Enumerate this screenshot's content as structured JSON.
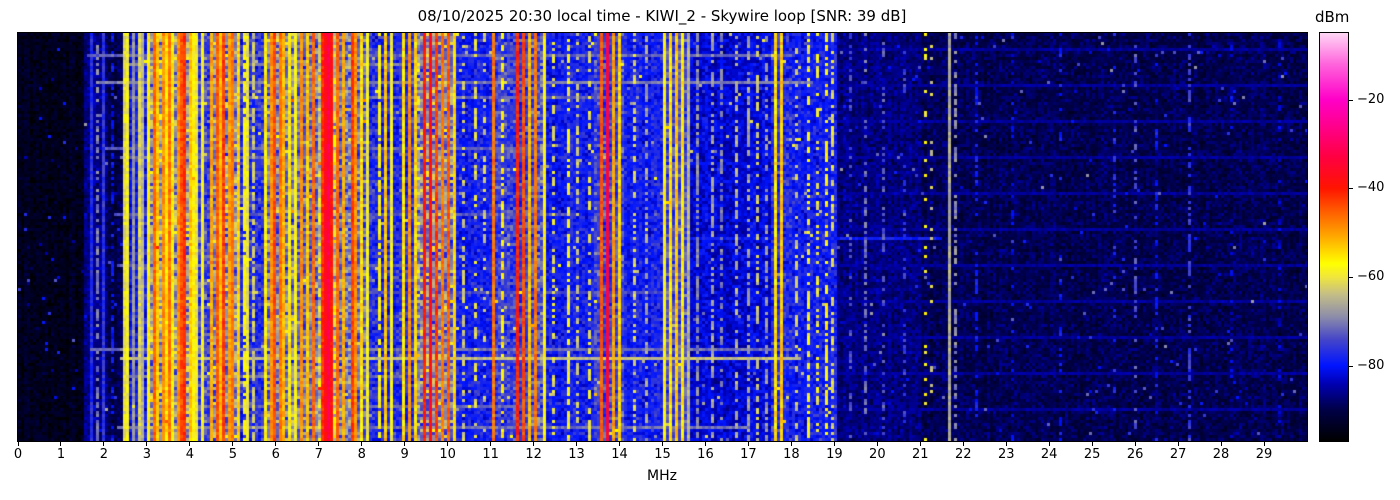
{
  "chart_data": {
    "type": "heatmap",
    "subtype": "radio-spectrogram-waterfall",
    "title": "08/10/2025 20:30 local time - KIWI_2 - Skywire loop [SNR: 39 dB]",
    "xlabel": "MHz",
    "x_range": [
      0,
      30
    ],
    "x_ticks": [
      0,
      1,
      2,
      3,
      4,
      5,
      6,
      7,
      8,
      9,
      10,
      11,
      12,
      13,
      14,
      15,
      16,
      17,
      18,
      19,
      20,
      21,
      22,
      23,
      24,
      25,
      26,
      27,
      28,
      29
    ],
    "y_ticks": [],
    "grid": false,
    "noise_seed": 7,
    "colorbar": {
      "label": "dBm",
      "ticks": [
        -20,
        -40,
        -60,
        -80
      ],
      "tick_labels": [
        "−20",
        "−40",
        "−60",
        "−80"
      ],
      "range": [
        -97,
        -5
      ],
      "colormap": [
        [
          -97,
          "#000000"
        ],
        [
          -90,
          "#000046"
        ],
        [
          -84,
          "#0000b4"
        ],
        [
          -80,
          "#0014ff"
        ],
        [
          -74,
          "#4646c8"
        ],
        [
          -69,
          "#8c8caa"
        ],
        [
          -64,
          "#c3bd87"
        ],
        [
          -60,
          "#f0e63c"
        ],
        [
          -57,
          "#ffff00"
        ],
        [
          -51,
          "#ffaa00"
        ],
        [
          -45,
          "#ff5a00"
        ],
        [
          -40,
          "#ff1400"
        ],
        [
          -33,
          "#ff0041"
        ],
        [
          -26,
          "#ff008c"
        ],
        [
          -20,
          "#ff00c8"
        ],
        [
          -12,
          "#ff64dc"
        ],
        [
          -5,
          "#ffd7f5"
        ]
      ]
    },
    "baseline_format": [
      "f0_MHz",
      "f1_MHz",
      "base_dBm",
      "spread_dB"
    ],
    "baseline": [
      [
        0.0,
        1.55,
        -94,
        2.5
      ],
      [
        1.55,
        2.08,
        -86.5,
        3
      ],
      [
        2.08,
        2.5,
        -90,
        3
      ],
      [
        2.5,
        3.0,
        -79,
        5
      ],
      [
        3.0,
        4.1,
        -68,
        8
      ],
      [
        4.1,
        4.5,
        -75,
        6
      ],
      [
        4.5,
        5.15,
        -69,
        8
      ],
      [
        5.15,
        5.7,
        -77,
        5
      ],
      [
        5.7,
        6.4,
        -69,
        8
      ],
      [
        6.4,
        7.0,
        -71,
        7
      ],
      [
        7.0,
        7.45,
        -63,
        8
      ],
      [
        7.45,
        8.1,
        -71,
        7
      ],
      [
        8.1,
        9.3,
        -77,
        5
      ],
      [
        9.3,
        10.2,
        -69,
        8
      ],
      [
        10.2,
        11.1,
        -79,
        4
      ],
      [
        11.1,
        11.9,
        -75,
        5
      ],
      [
        11.9,
        12.3,
        -73,
        6
      ],
      [
        12.3,
        13.4,
        -79,
        4
      ],
      [
        13.4,
        14.1,
        -75,
        5
      ],
      [
        14.1,
        15.0,
        -79,
        4
      ],
      [
        15.0,
        15.55,
        -75,
        5
      ],
      [
        15.55,
        17.5,
        -82,
        3.5
      ],
      [
        17.5,
        18.0,
        -77,
        5
      ],
      [
        18.0,
        19.05,
        -79,
        4
      ],
      [
        19.05,
        21.0,
        -87,
        3
      ],
      [
        21.0,
        30.01,
        -89.5,
        3
      ]
    ],
    "lines_format": [
      "f_MHz",
      "width_MHz",
      "peak_dBm",
      "duty"
    ],
    "lines": [
      [
        1.71,
        0.04,
        -77
      ],
      [
        1.87,
        0.05,
        -70,
        0.6
      ],
      [
        1.97,
        0.04,
        -76
      ],
      [
        2.17,
        0.03,
        -80,
        0.5
      ],
      [
        2.47,
        0.035,
        -61
      ],
      [
        2.57,
        0.05,
        -59
      ],
      [
        2.72,
        0.04,
        -68
      ],
      [
        2.82,
        0.05,
        -62
      ],
      [
        2.93,
        0.04,
        -65
      ],
      [
        3.06,
        0.05,
        -57
      ],
      [
        3.18,
        0.06,
        -46
      ],
      [
        3.27,
        0.04,
        -53
      ],
      [
        3.35,
        0.06,
        -49
      ],
      [
        3.44,
        0.05,
        -55
      ],
      [
        3.53,
        0.06,
        -47
      ],
      [
        3.62,
        0.05,
        -56
      ],
      [
        3.72,
        0.07,
        -49
      ],
      [
        3.81,
        0.05,
        -44
      ],
      [
        3.9,
        0.05,
        -42
      ],
      [
        3.99,
        0.05,
        -53
      ],
      [
        4.07,
        0.04,
        -57
      ],
      [
        4.17,
        0.04,
        -60
      ],
      [
        4.3,
        0.04,
        -59
      ],
      [
        4.48,
        0.06,
        -51
      ],
      [
        4.62,
        0.05,
        -45
      ],
      [
        4.72,
        0.04,
        -52
      ],
      [
        4.8,
        0.06,
        -43
      ],
      [
        4.9,
        0.05,
        -50
      ],
      [
        5.01,
        0.06,
        -47
      ],
      [
        5.1,
        0.04,
        -54
      ],
      [
        5.24,
        0.04,
        -58,
        0.8
      ],
      [
        5.37,
        0.04,
        -60
      ],
      [
        5.49,
        0.03,
        -63,
        0.7
      ],
      [
        5.76,
        0.05,
        -56
      ],
      [
        5.87,
        0.06,
        -49
      ],
      [
        5.97,
        0.07,
        -44
      ],
      [
        6.07,
        0.06,
        -47
      ],
      [
        6.18,
        0.05,
        -52
      ],
      [
        6.31,
        0.05,
        -56
      ],
      [
        6.45,
        0.04,
        -58
      ],
      [
        6.62,
        0.06,
        -49
      ],
      [
        6.74,
        0.05,
        -53
      ],
      [
        6.89,
        0.06,
        -46
      ],
      [
        7.06,
        0.06,
        -42
      ],
      [
        7.16,
        0.05,
        -37
      ],
      [
        7.24,
        0.05,
        -32
      ],
      [
        7.32,
        0.05,
        -39
      ],
      [
        7.43,
        0.05,
        -46
      ],
      [
        7.6,
        0.06,
        -51
      ],
      [
        7.77,
        0.06,
        -43
      ],
      [
        7.87,
        0.05,
        -49
      ],
      [
        8.02,
        0.05,
        -55
      ],
      [
        8.14,
        0.04,
        -59
      ],
      [
        8.38,
        0.05,
        -57,
        0.8
      ],
      [
        8.58,
        0.05,
        -53
      ],
      [
        8.72,
        0.04,
        -59
      ],
      [
        8.95,
        0.05,
        -55
      ],
      [
        9.07,
        0.05,
        -49
      ],
      [
        9.22,
        0.04,
        -54
      ],
      [
        9.44,
        0.06,
        -40
      ],
      [
        9.57,
        0.05,
        -38
      ],
      [
        9.7,
        0.05,
        -43
      ],
      [
        9.84,
        0.05,
        -47
      ],
      [
        10.02,
        0.06,
        -45
      ],
      [
        10.14,
        0.04,
        -54
      ],
      [
        10.38,
        0.03,
        -63,
        0.5
      ],
      [
        10.62,
        0.04,
        -61,
        0.4
      ],
      [
        10.88,
        0.04,
        -63,
        0.35
      ],
      [
        11.07,
        0.05,
        -47
      ],
      [
        11.28,
        0.05,
        -56,
        0.6
      ],
      [
        11.63,
        0.06,
        -41
      ],
      [
        11.77,
        0.05,
        -44
      ],
      [
        11.92,
        0.04,
        -52
      ],
      [
        12.06,
        0.05,
        -47
      ],
      [
        12.22,
        0.04,
        -57
      ],
      [
        12.48,
        0.04,
        -61,
        0.5
      ],
      [
        12.78,
        0.04,
        -59,
        0.6
      ],
      [
        13.03,
        0.04,
        -63,
        0.5
      ],
      [
        13.32,
        0.04,
        -61,
        0.5
      ],
      [
        13.58,
        0.05,
        -45
      ],
      [
        13.7,
        0.08,
        -34
      ],
      [
        13.82,
        0.04,
        -50
      ],
      [
        14.02,
        0.05,
        -54
      ],
      [
        14.37,
        0.04,
        -62,
        0.5
      ],
      [
        14.63,
        0.03,
        -67,
        0.5
      ],
      [
        15.02,
        0.04,
        -57
      ],
      [
        15.17,
        0.04,
        -55
      ],
      [
        15.32,
        0.05,
        -53
      ],
      [
        15.45,
        0.04,
        -56
      ],
      [
        15.62,
        0.03,
        -65
      ],
      [
        15.82,
        0.03,
        -69,
        0.7
      ],
      [
        16.12,
        0.03,
        -67,
        0.6
      ],
      [
        16.37,
        0.03,
        -69,
        0.5
      ],
      [
        16.72,
        0.03,
        -65,
        0.5
      ],
      [
        16.97,
        0.03,
        -67,
        0.6
      ],
      [
        17.22,
        0.03,
        -63,
        0.5
      ],
      [
        17.4,
        0.03,
        -68,
        0.5
      ],
      [
        17.63,
        0.06,
        -55
      ],
      [
        17.76,
        0.06,
        -53
      ],
      [
        18.12,
        0.03,
        -63,
        0.4
      ],
      [
        18.37,
        0.04,
        -59,
        0.5
      ],
      [
        18.57,
        0.03,
        -60,
        0.4
      ],
      [
        18.82,
        0.04,
        -57,
        0.6
      ],
      [
        18.97,
        0.03,
        -61,
        0.5
      ],
      [
        19.33,
        0.025,
        -74,
        0.3
      ],
      [
        19.68,
        0.025,
        -71,
        0.4
      ],
      [
        20.12,
        0.025,
        -73,
        0.3
      ],
      [
        20.63,
        0.025,
        -75,
        0.3
      ],
      [
        21.12,
        0.04,
        -58,
        0.15
      ],
      [
        21.27,
        0.03,
        -63,
        0.2
      ],
      [
        21.68,
        0.04,
        -66
      ],
      [
        21.79,
        0.03,
        -69,
        0.5
      ],
      [
        22.32,
        0.025,
        -79,
        0.3
      ],
      [
        23.12,
        0.025,
        -81,
        0.25
      ],
      [
        24.22,
        0.025,
        -79,
        0.2
      ],
      [
        25.47,
        0.025,
        -77,
        0.15
      ],
      [
        26.02,
        0.03,
        -73,
        0.25
      ],
      [
        26.47,
        0.025,
        -79,
        0.25
      ],
      [
        27.22,
        0.03,
        -75,
        0.5
      ],
      [
        28.22,
        0.025,
        -83,
        0.3
      ],
      [
        29.32,
        0.025,
        -83,
        0.3
      ]
    ],
    "streaks_format": [
      "y_fraction",
      "f0_MHz",
      "f1_MHz",
      "level_dBm"
    ],
    "streaks": [
      [
        0.055,
        1.6,
        18.0,
        -72
      ],
      [
        0.075,
        2.5,
        9.0,
        -70
      ],
      [
        0.12,
        1.8,
        18.5,
        -70
      ],
      [
        0.155,
        2.5,
        14.0,
        -72
      ],
      [
        0.185,
        3.3,
        8.0,
        -73
      ],
      [
        0.28,
        2.0,
        12.0,
        -72
      ],
      [
        0.3,
        2.4,
        7.5,
        -71
      ],
      [
        0.44,
        2.2,
        13.0,
        -73
      ],
      [
        0.5,
        11.0,
        21.5,
        -79
      ],
      [
        0.565,
        2.3,
        9.5,
        -73
      ],
      [
        0.63,
        3.0,
        15.0,
        -74
      ],
      [
        0.77,
        1.7,
        18.0,
        -71
      ],
      [
        0.792,
        2.4,
        18.2,
        -64
      ],
      [
        0.84,
        2.5,
        9.0,
        -71
      ],
      [
        0.91,
        3.0,
        12.0,
        -72
      ],
      [
        0.965,
        2.3,
        17.0,
        -71
      ]
    ],
    "periodic_rows": {
      "period": 12,
      "offset": 5,
      "f0": 12.5,
      "f1": 30,
      "level": -85.5
    }
  }
}
